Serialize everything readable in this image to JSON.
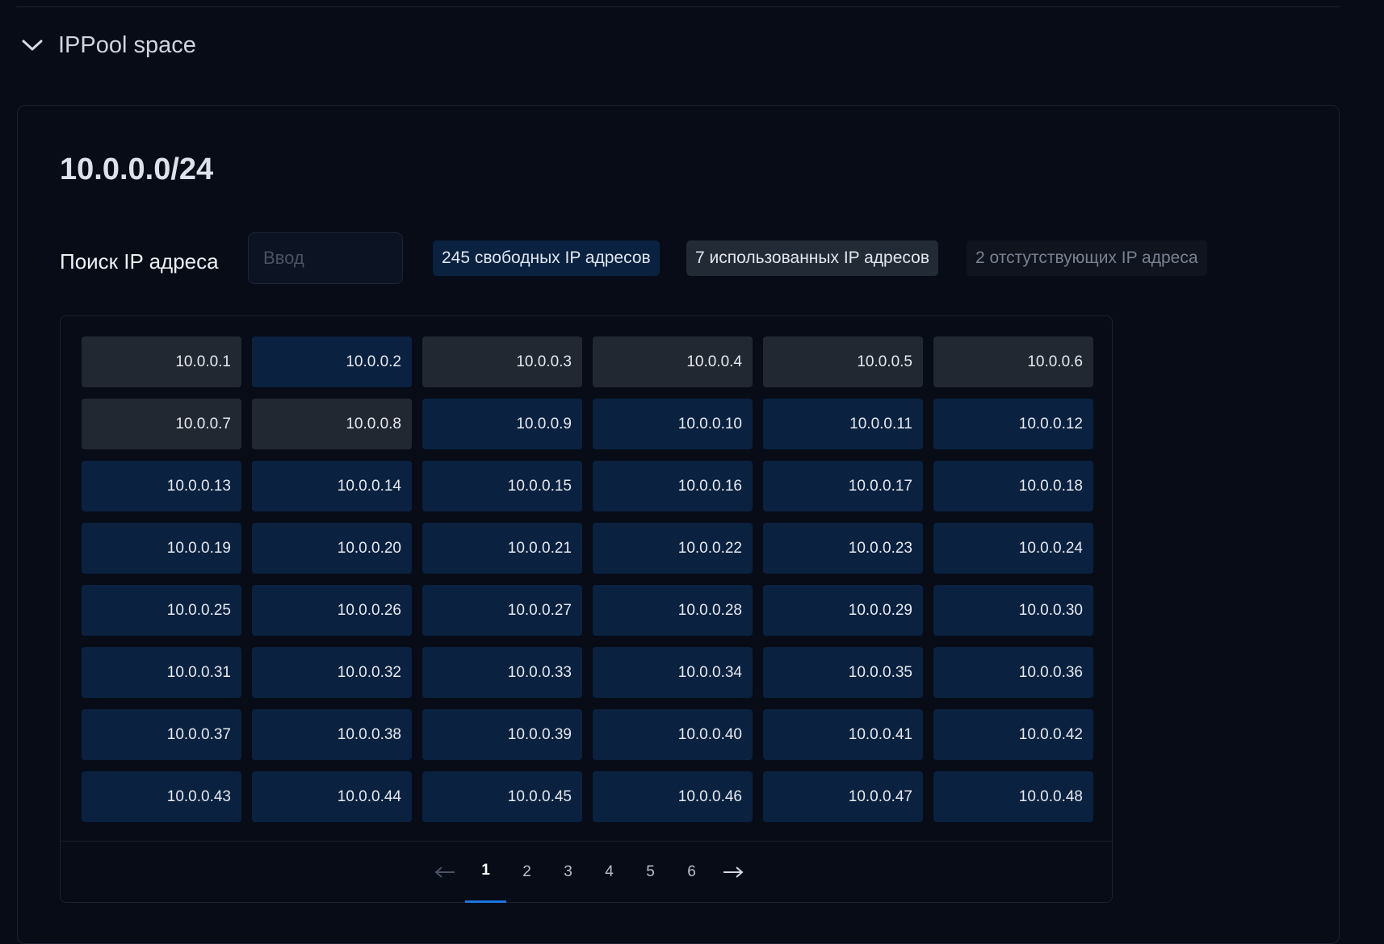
{
  "section": {
    "title": "IPPool space",
    "expanded": true
  },
  "pool": {
    "cidr": "10.0.0.0/24",
    "search_label": "Поиск IP адреса",
    "search_placeholder": "Ввод",
    "search_value": "",
    "badges": {
      "free": "245 свободных IP адресов",
      "used": "7 использованных IP адресов",
      "missing": "2 отстутствующих IP адреса"
    }
  },
  "ips": [
    {
      "ip": "10.0.0.1",
      "status": "used"
    },
    {
      "ip": "10.0.0.2",
      "status": "free"
    },
    {
      "ip": "10.0.0.3",
      "status": "used"
    },
    {
      "ip": "10.0.0.4",
      "status": "used"
    },
    {
      "ip": "10.0.0.5",
      "status": "used"
    },
    {
      "ip": "10.0.0.6",
      "status": "used"
    },
    {
      "ip": "10.0.0.7",
      "status": "used"
    },
    {
      "ip": "10.0.0.8",
      "status": "used"
    },
    {
      "ip": "10.0.0.9",
      "status": "free"
    },
    {
      "ip": "10.0.0.10",
      "status": "free"
    },
    {
      "ip": "10.0.0.11",
      "status": "free"
    },
    {
      "ip": "10.0.0.12",
      "status": "free"
    },
    {
      "ip": "10.0.0.13",
      "status": "free"
    },
    {
      "ip": "10.0.0.14",
      "status": "free"
    },
    {
      "ip": "10.0.0.15",
      "status": "free"
    },
    {
      "ip": "10.0.0.16",
      "status": "free"
    },
    {
      "ip": "10.0.0.17",
      "status": "free"
    },
    {
      "ip": "10.0.0.18",
      "status": "free"
    },
    {
      "ip": "10.0.0.19",
      "status": "free"
    },
    {
      "ip": "10.0.0.20",
      "status": "free"
    },
    {
      "ip": "10.0.0.21",
      "status": "free"
    },
    {
      "ip": "10.0.0.22",
      "status": "free"
    },
    {
      "ip": "10.0.0.23",
      "status": "free"
    },
    {
      "ip": "10.0.0.24",
      "status": "free"
    },
    {
      "ip": "10.0.0.25",
      "status": "free"
    },
    {
      "ip": "10.0.0.26",
      "status": "free"
    },
    {
      "ip": "10.0.0.27",
      "status": "free"
    },
    {
      "ip": "10.0.0.28",
      "status": "free"
    },
    {
      "ip": "10.0.0.29",
      "status": "free"
    },
    {
      "ip": "10.0.0.30",
      "status": "free"
    },
    {
      "ip": "10.0.0.31",
      "status": "free"
    },
    {
      "ip": "10.0.0.32",
      "status": "free"
    },
    {
      "ip": "10.0.0.33",
      "status": "free"
    },
    {
      "ip": "10.0.0.34",
      "status": "free"
    },
    {
      "ip": "10.0.0.35",
      "status": "free"
    },
    {
      "ip": "10.0.0.36",
      "status": "free"
    },
    {
      "ip": "10.0.0.37",
      "status": "free"
    },
    {
      "ip": "10.0.0.38",
      "status": "free"
    },
    {
      "ip": "10.0.0.39",
      "status": "free"
    },
    {
      "ip": "10.0.0.40",
      "status": "free"
    },
    {
      "ip": "10.0.0.41",
      "status": "free"
    },
    {
      "ip": "10.0.0.42",
      "status": "free"
    },
    {
      "ip": "10.0.0.43",
      "status": "free"
    },
    {
      "ip": "10.0.0.44",
      "status": "free"
    },
    {
      "ip": "10.0.0.45",
      "status": "free"
    },
    {
      "ip": "10.0.0.46",
      "status": "free"
    },
    {
      "ip": "10.0.0.47",
      "status": "free"
    },
    {
      "ip": "10.0.0.48",
      "status": "free"
    }
  ],
  "pagination": {
    "prev_icon": "arrow-left-icon",
    "next_icon": "arrow-right-icon",
    "pages": [
      "1",
      "2",
      "3",
      "4",
      "5",
      "6"
    ],
    "current": "1"
  },
  "colors": {
    "background": "#070c17",
    "free_cell": "#0b2140",
    "used_cell": "#222831",
    "accent": "#1a75e0"
  }
}
